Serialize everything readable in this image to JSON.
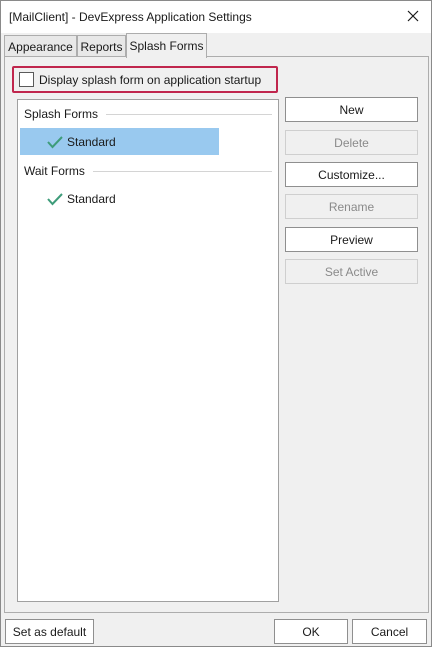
{
  "window": {
    "title": "[MailClient] - DevExpress Application Settings"
  },
  "tabs": [
    {
      "label": "Appearance",
      "active": false
    },
    {
      "label": "Reports",
      "active": false
    },
    {
      "label": "Splash Forms",
      "active": true
    }
  ],
  "startup": {
    "label": "Display splash form on application startup",
    "checked": false
  },
  "tree": {
    "groups": [
      {
        "header": "Splash Forms",
        "items": [
          {
            "label": "Standard",
            "active": true,
            "selected": true
          }
        ]
      },
      {
        "header": "Wait Forms",
        "items": [
          {
            "label": "Standard",
            "active": true,
            "selected": false
          }
        ]
      }
    ]
  },
  "side_buttons": {
    "new": "New",
    "delete": "Delete",
    "customize": "Customize...",
    "rename": "Rename",
    "preview": "Preview",
    "set_active": "Set Active"
  },
  "footer": {
    "set_default": "Set as default",
    "ok": "OK",
    "cancel": "Cancel"
  },
  "colors": {
    "highlight_border": "#c0264d",
    "selection": "#99c9ef",
    "check": "#3e9c7a"
  }
}
